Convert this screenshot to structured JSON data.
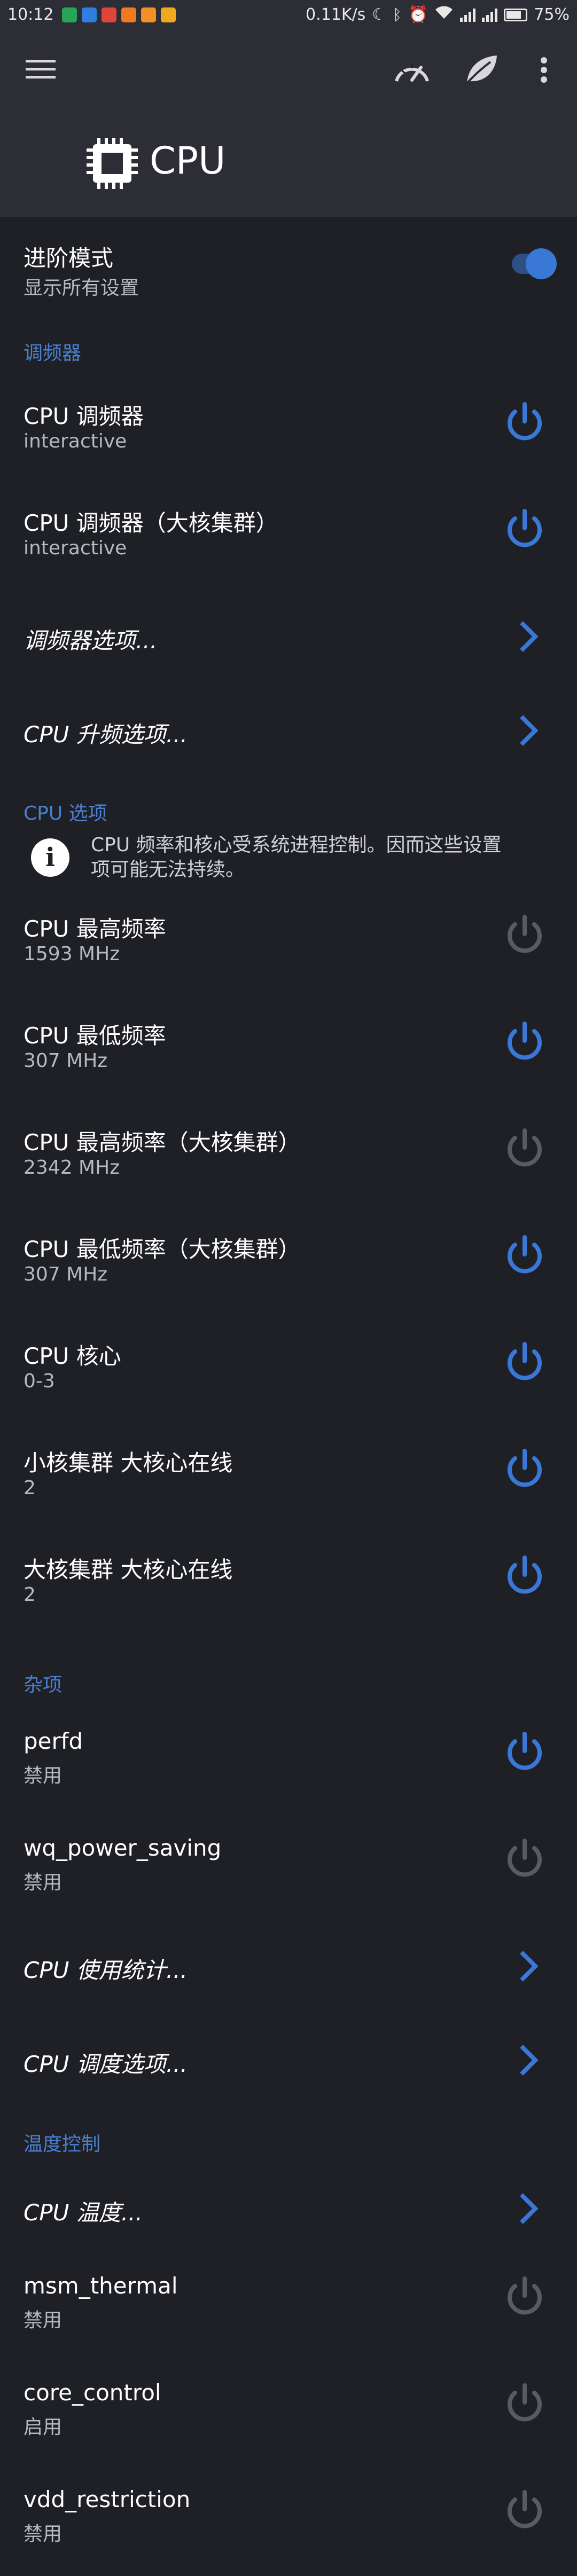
{
  "status_bar": {
    "time": "10:12",
    "net_speed": "0.11K/s",
    "battery": "75%",
    "notification_icons": [
      {
        "name": "shield-app-icon",
        "color": "#27a35a"
      },
      {
        "name": "shield-blue-icon",
        "color": "#2f7fe0"
      },
      {
        "name": "red-app-icon",
        "color": "#e0443a"
      },
      {
        "name": "orange-app-icon",
        "color": "#f07a20"
      },
      {
        "name": "orange-app-icon-2",
        "color": "#f29025"
      },
      {
        "name": "yellow-app-icon",
        "color": "#f0a820"
      }
    ]
  },
  "toolbar": {
    "menu_icon": "hamburger-icon",
    "speed_icon": "speedometer-icon",
    "leaf_icon": "leaf-icon",
    "more_icon": "more-vert-icon"
  },
  "app": {
    "title": "CPU"
  },
  "colors": {
    "accent": "#3a78d8",
    "bg": "#1f2026",
    "header_bg": "#2c2d35",
    "section": "#4a7fd0",
    "disabled_power": "#5a5b62"
  },
  "advanced": {
    "title": "进阶模式",
    "subtitle": "显示所有设置",
    "enabled": true
  },
  "sections": {
    "governor": "调频器",
    "cpu_options": "CPU 选项",
    "misc": "杂项",
    "thermal": "温度控制"
  },
  "governor_rows": [
    {
      "title": "CPU 调频器",
      "subtitle": "interactive",
      "type": "power",
      "enabled": true
    },
    {
      "title": "CPU 调频器（大核集群）",
      "subtitle": "interactive",
      "type": "power",
      "enabled": true
    },
    {
      "title": "调频器选项...",
      "type": "link"
    },
    {
      "title": "CPU 升频选项...",
      "type": "link"
    }
  ],
  "info_note": "CPU 频率和核心受系统进程控制。因而这些设置项可能无法持续。",
  "cpu_rows": [
    {
      "title": "CPU 最高频率",
      "subtitle": "1593 MHz",
      "enabled": false
    },
    {
      "title": "CPU 最低频率",
      "subtitle": "307 MHz",
      "enabled": true
    },
    {
      "title": "CPU 最高频率（大核集群）",
      "subtitle": "2342 MHz",
      "enabled": false
    },
    {
      "title": "CPU 最低频率（大核集群）",
      "subtitle": "307 MHz",
      "enabled": true
    },
    {
      "title": "CPU 核心",
      "subtitle": "0-3",
      "enabled": true
    },
    {
      "title": "小核集群 大核心在线",
      "subtitle": "2",
      "enabled": true
    },
    {
      "title": "大核集群 大核心在线",
      "subtitle": "2",
      "enabled": true
    }
  ],
  "misc_rows": [
    {
      "title": "perfd",
      "subtitle": "禁用",
      "type": "power",
      "enabled": true
    },
    {
      "title": "wq_power_saving",
      "subtitle": "禁用",
      "type": "power",
      "enabled": false
    },
    {
      "title": "CPU 使用统计...",
      "type": "link"
    },
    {
      "title": "CPU 调度选项...",
      "type": "link"
    }
  ],
  "thermal_rows": [
    {
      "title": "CPU 温度...",
      "type": "link"
    },
    {
      "title": "msm_thermal",
      "subtitle": "禁用",
      "type": "power",
      "enabled": false
    },
    {
      "title": "core_control",
      "subtitle": "启用",
      "type": "power",
      "enabled": false
    },
    {
      "title": "vdd_restriction",
      "subtitle": "禁用",
      "type": "power",
      "enabled": false
    }
  ]
}
